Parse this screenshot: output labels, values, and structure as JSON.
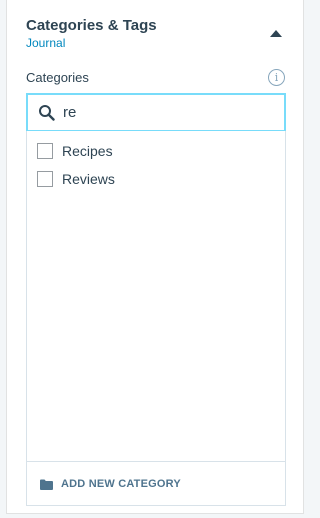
{
  "panel": {
    "title": "Categories & Tags",
    "subtitle": "Journal",
    "collapse_icon": "chevron-up-icon"
  },
  "categories": {
    "label": "Categories",
    "info_icon": "info-icon",
    "info_glyph": "i",
    "search": {
      "icon": "search-icon",
      "value": "re"
    },
    "items": [
      {
        "label": "Recipes",
        "checked": false
      },
      {
        "label": "Reviews",
        "checked": false
      }
    ],
    "add_button": {
      "icon": "folder-icon",
      "label": "ADD NEW CATEGORY"
    }
  },
  "colors": {
    "accent_link": "#0087be",
    "focus_border": "#78dcfa",
    "text": "#2e4453",
    "muted": "#87a6bc"
  }
}
